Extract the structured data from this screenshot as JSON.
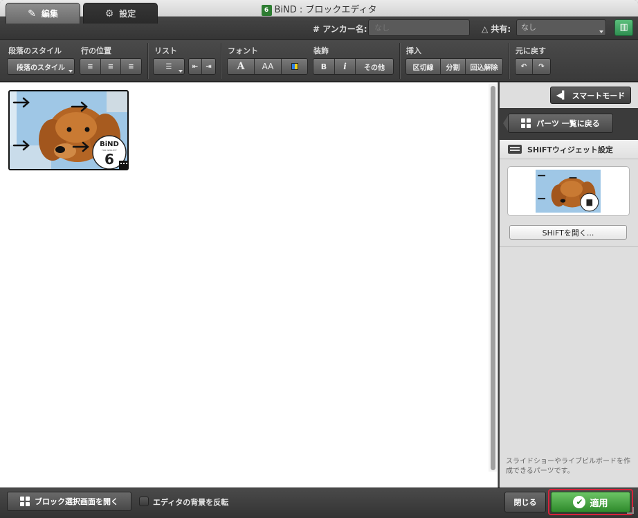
{
  "window": {
    "title": "BiND : ブロックエディタ",
    "app_badge": "6"
  },
  "tabs": [
    {
      "label": "編集",
      "icon": "pencil-icon",
      "active": true
    },
    {
      "label": "設定",
      "icon": "gear-icon",
      "active": false
    }
  ],
  "anchor": {
    "label": "# アンカー名:",
    "placeholder": "なし"
  },
  "share": {
    "label": "共有:",
    "value": "なし"
  },
  "toolbar": {
    "paragraph": {
      "label": "段落のスタイル",
      "button": "段落のスタイル"
    },
    "alignment": {
      "label": "行の位置",
      "buttons": [
        "≡",
        "≡",
        "≡"
      ]
    },
    "list": {
      "label": "リスト",
      "buttons": [
        "☰",
        "⇤",
        "⇥"
      ]
    },
    "font": {
      "label": "フォント",
      "buttons": [
        "A",
        "AA"
      ]
    },
    "decoration": {
      "label": "装飾",
      "buttons": [
        "B",
        "i",
        "その他"
      ]
    },
    "insert": {
      "label": "挿入",
      "buttons": [
        "区切線",
        "分割",
        "回込解除"
      ]
    },
    "undo": {
      "label": "元に戻す",
      "buttons": [
        "↶",
        "↷"
      ]
    }
  },
  "canvas": {
    "thumbnail_badge_brand": "BiND",
    "thumbnail_badge_sub": "FOR WEBLIFE*",
    "thumbnail_badge_num": "6"
  },
  "right_panel": {
    "smart_mode": "スマートモード",
    "back_to_parts": "パーツ 一覧に戻る",
    "widget_settings": "SHiFTウィジェット設定",
    "open_shift": "SHiFTを開く...",
    "description": "スライドショーやライブビルボードを作成できるパーツです。"
  },
  "bottom": {
    "open_block_select": "ブロック選択画面を開く",
    "invert_background": "エディタの背景を反転",
    "close": "閉じる",
    "apply": "適用"
  },
  "colors": {
    "apply_green": "#2f8a2c",
    "highlight_red": "#d6233a",
    "accent_teal": "#2f8f51"
  }
}
